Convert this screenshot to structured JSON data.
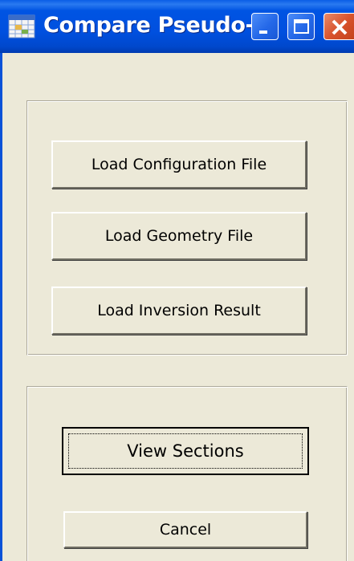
{
  "window": {
    "title": "Compare Pseudo-...",
    "icon": "grid-app-icon",
    "controls": [
      "minimize-icon",
      "maximize-icon",
      "close-icon"
    ],
    "title_bar_color": "#0054e3",
    "close_button_color": "#d9542e",
    "face_color": "#ece9d8"
  },
  "load_panel": {
    "load_configuration_label": "Load Configuration File",
    "load_geometry_label": "Load Geometry File",
    "load_inversion_label": "Load Inversion Result"
  },
  "action_panel": {
    "view_sections_label": "View Sections",
    "cancel_label": "Cancel"
  }
}
